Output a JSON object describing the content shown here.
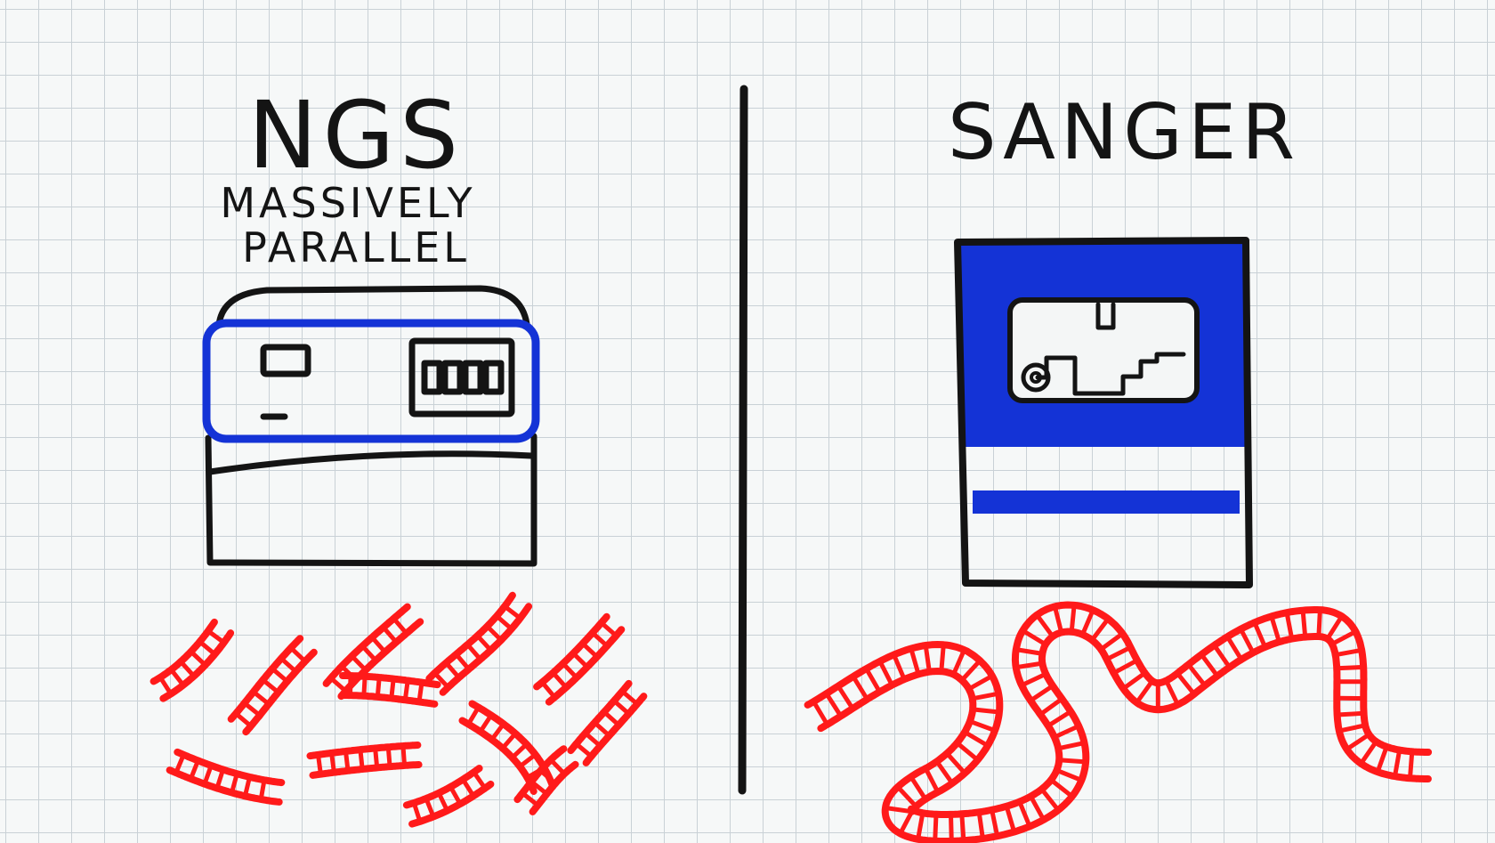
{
  "left_panel": {
    "title": "NGS",
    "subtitle_line1": "MASSIVELY",
    "subtitle_line2": "PARALLEL",
    "machine_icon": "ngs-sequencer-icon",
    "dna_icon": "short-dna-fragments-icon",
    "fragment_count": 12
  },
  "right_panel": {
    "title": "SANGER",
    "machine_icon": "sanger-sequencer-icon",
    "dna_icon": "long-dna-strand-icon"
  },
  "colors": {
    "ink": "#141414",
    "blue": "#1433d6",
    "red": "#ff1a1a",
    "grid": "#c9d1d6",
    "paper": "#f6f8f8"
  }
}
